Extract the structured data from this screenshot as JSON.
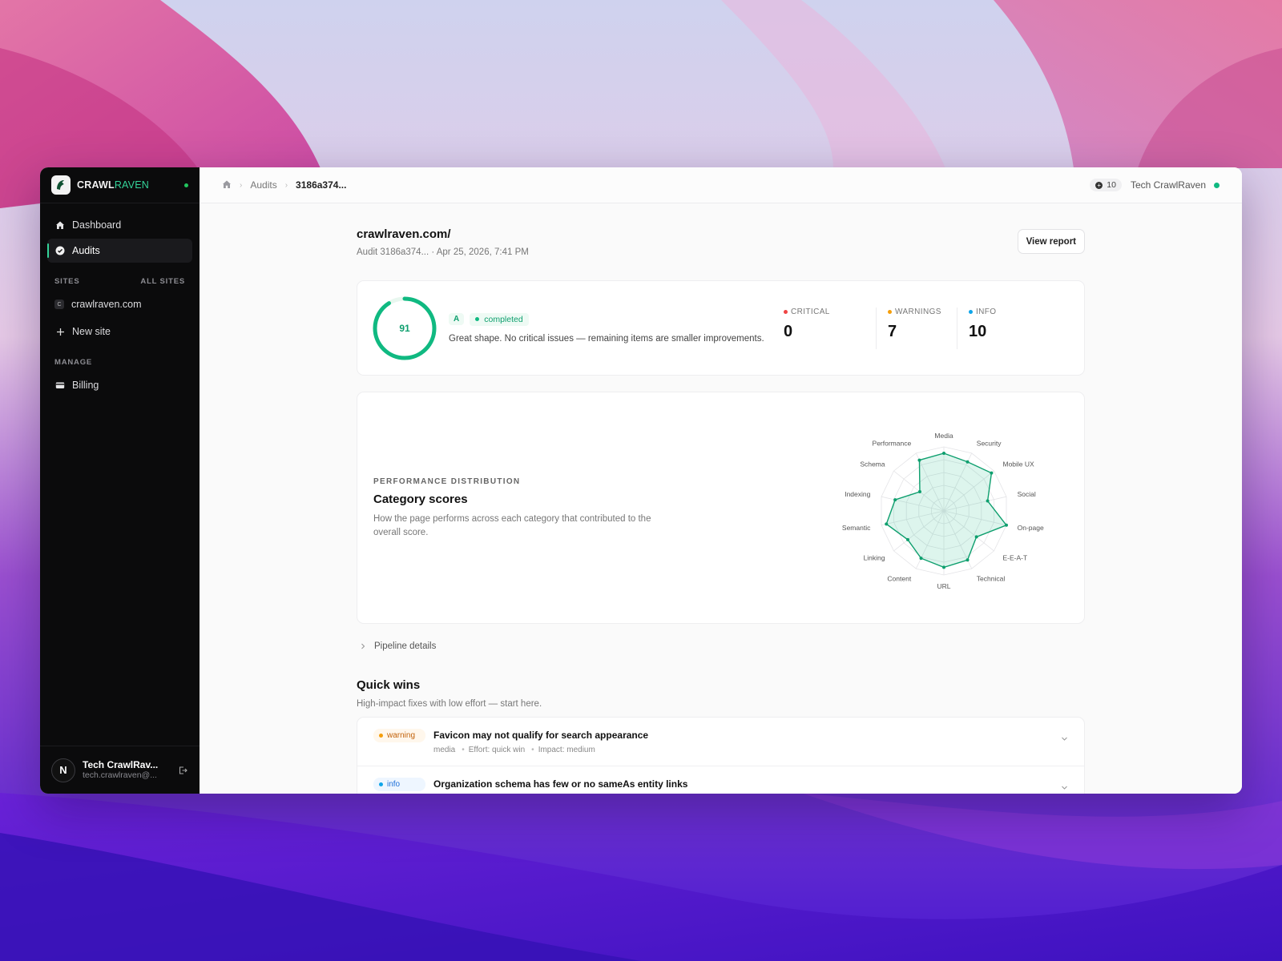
{
  "brand": {
    "name_primary": "CRAWL",
    "name_secondary": "RAVEN"
  },
  "sidebar": {
    "nav": [
      {
        "label": "Dashboard",
        "icon": "home-icon",
        "active": false
      },
      {
        "label": "Audits",
        "icon": "check-circle-icon",
        "active": true
      }
    ],
    "sites_label": "SITES",
    "all_sites_label": "ALL SITES",
    "sites": [
      {
        "badge": "C",
        "label": "crawlraven.com"
      }
    ],
    "new_site_label": "New site",
    "manage_label": "MANAGE",
    "manage_items": [
      {
        "label": "Billing",
        "icon": "card-icon"
      }
    ],
    "user": {
      "initial": "N",
      "name": "Tech CrawlRav...",
      "email": "tech.crawlraven@..."
    }
  },
  "topbar": {
    "breadcrumb": [
      "Audits",
      "3186a374..."
    ],
    "credits": "10",
    "account_name": "Tech CrawlRaven"
  },
  "page": {
    "title": "crawlraven.com/",
    "subtitle": "Audit 3186a374... · Apr 25, 2026, 7:41 PM",
    "view_report_label": "View report"
  },
  "score": {
    "value": 91,
    "max": 100,
    "grade": "A",
    "status": "completed",
    "summary": "Great shape. No critical issues — remaining items are smaller improvements.",
    "counts": [
      {
        "label": "CRITICAL",
        "value": "0",
        "color": "#ef4444"
      },
      {
        "label": "WARNINGS",
        "value": "7",
        "color": "#f59e0b"
      },
      {
        "label": "INFO",
        "value": "10",
        "color": "#0ea5e9"
      }
    ]
  },
  "distribution": {
    "eyebrow": "PERFORMANCE DISTRIBUTION",
    "title": "Category scores",
    "description": "How the page performs across each category that contributed to the overall score."
  },
  "chart_data": {
    "type": "radar",
    "categories": [
      "Media",
      "Security",
      "Mobile UX",
      "Social",
      "On-page",
      "E-E-A-T",
      "Technical",
      "URL",
      "Content",
      "Linking",
      "Semantic",
      "Indexing",
      "Schema",
      "Performance"
    ],
    "values": [
      90,
      85,
      95,
      70,
      100,
      65,
      85,
      88,
      82,
      72,
      92,
      78,
      48,
      88
    ],
    "range": [
      0,
      100
    ],
    "color": "#10b981"
  },
  "pipeline_label": "Pipeline details",
  "quick_wins": {
    "title": "Quick wins",
    "subtitle": "High-impact fixes with low effort — start here.",
    "items": [
      {
        "severity": "warning",
        "title": "Favicon may not qualify for search appearance",
        "meta": [
          "media",
          "Effort: quick win",
          "Impact: medium"
        ]
      },
      {
        "severity": "info",
        "title": "Organization schema has few or no sameAs entity links",
        "meta": []
      }
    ]
  },
  "colors": {
    "accent": "#10b981",
    "sidebar_bg": "#0b0b0c"
  }
}
